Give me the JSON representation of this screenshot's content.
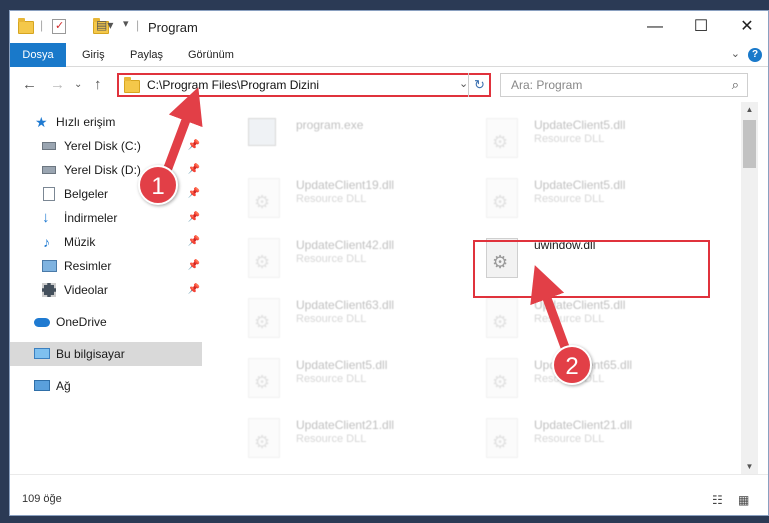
{
  "window": {
    "title": "Program"
  },
  "controls": {
    "minimize": "—",
    "maximize": "☐",
    "close": "✕"
  },
  "ribbon": {
    "tabs": [
      "Dosya",
      "Giriş",
      "Paylaş",
      "Görünüm"
    ],
    "help": "?"
  },
  "address_bar": {
    "path": "C:\\Program Files\\Program Dizini",
    "search_placeholder": "Ara: Program"
  },
  "sidebar": {
    "items": [
      {
        "label": "Hızlı erişim",
        "icon": "star-icon",
        "pinned": false
      },
      {
        "label": "Yerel Disk (C:)",
        "icon": "drive-icon",
        "pinned": true
      },
      {
        "label": "Yerel Disk (D:)",
        "icon": "drive-icon",
        "pinned": true
      },
      {
        "label": "Belgeler",
        "icon": "documents-icon",
        "pinned": true
      },
      {
        "label": "İndirmeler",
        "icon": "downloads-icon",
        "pinned": true
      },
      {
        "label": "Müzik",
        "icon": "music-icon",
        "pinned": true
      },
      {
        "label": "Resimler",
        "icon": "pictures-icon",
        "pinned": true
      },
      {
        "label": "Videolar",
        "icon": "videos-icon",
        "pinned": true
      },
      {
        "label": "OneDrive",
        "icon": "cloud-icon",
        "pinned": false
      },
      {
        "label": "Bu bilgisayar",
        "icon": "computer-icon",
        "pinned": false
      },
      {
        "label": "Ağ",
        "icon": "network-icon",
        "pinned": false
      }
    ]
  },
  "files": [
    {
      "name": "program.exe",
      "type": ""
    },
    {
      "name": "UpdateClient5.dll",
      "type": "Resource DLL"
    },
    {
      "name": "UpdateClient19.dll",
      "type": "Resource DLL"
    },
    {
      "name": "UpdateClient5.dll",
      "type": "Resource DLL"
    },
    {
      "name": "UpdateClient42.dll",
      "type": "Resource DLL"
    },
    {
      "name": "uwindow.dll",
      "type": ""
    },
    {
      "name": "UpdateClient63.dll",
      "type": "Resource DLL"
    },
    {
      "name": "UpdateClient5.dll",
      "type": "Resource DLL"
    },
    {
      "name": "UpdateClient5.dll",
      "type": "Resource DLL"
    },
    {
      "name": "UpdateClient65.dll",
      "type": "Resource DLL"
    },
    {
      "name": "UpdateClient21.dll",
      "type": "Resource DLL"
    },
    {
      "name": "UpdateClient21.dll",
      "type": "Resource DLL"
    }
  ],
  "status": {
    "item_count": "109 öğe"
  },
  "annotations": {
    "step1": "1",
    "step2": "2",
    "color": "#e23f47"
  }
}
